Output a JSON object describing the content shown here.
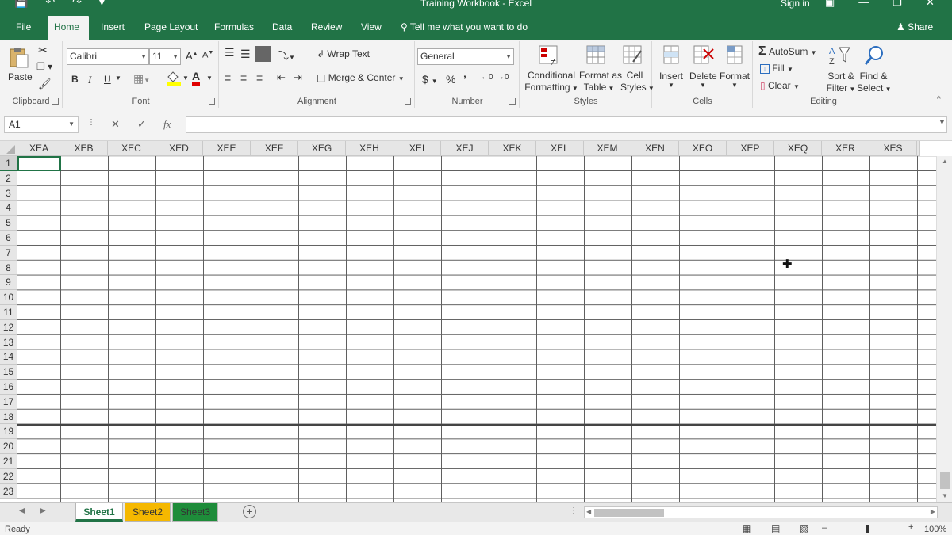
{
  "window": {
    "title": "Training Workbook - Excel",
    "signin": "Sign in"
  },
  "ribbon_tabs": [
    "File",
    "Home",
    "Insert",
    "Page Layout",
    "Formulas",
    "Data",
    "Review",
    "View"
  ],
  "active_tab": "Home",
  "tell_me": "Tell me what you want to do",
  "share": "Share",
  "clipboard": {
    "paste": "Paste",
    "label": "Clipboard"
  },
  "font": {
    "name": "Calibri",
    "size": "11",
    "bold": "B",
    "italic": "I",
    "underline": "U",
    "label": "Font"
  },
  "alignment": {
    "wrap_text": "Wrap Text",
    "merge_center": "Merge & Center",
    "label": "Alignment"
  },
  "number": {
    "format": "General",
    "currency": "$",
    "percent": "%",
    "comma": "’",
    "label": "Number"
  },
  "styles": {
    "conditional_formatting": [
      "Conditional",
      "Formatting"
    ],
    "format_as_table": [
      "Format as",
      "Table"
    ],
    "cell_styles": [
      "Cell",
      "Styles"
    ],
    "label": "Styles"
  },
  "cells_group": {
    "insert": "Insert",
    "delete": "Delete",
    "format": "Format",
    "label": "Cells"
  },
  "editing": {
    "autosum": "AutoSum",
    "fill": "Fill",
    "clear": "Clear",
    "sort_filter": [
      "Sort &",
      "Filter"
    ],
    "find_select": [
      "Find &",
      "Select"
    ],
    "label": "Editing"
  },
  "formula_bar": {
    "name_box": "A1",
    "fx": "fx",
    "value": ""
  },
  "columns": [
    "XEA",
    "XEB",
    "XEC",
    "XED",
    "XEE",
    "XEF",
    "XEG",
    "XEH",
    "XEI",
    "XEJ",
    "XEK",
    "XEL",
    "XEM",
    "XEN",
    "XEO",
    "XEP",
    "XEQ",
    "XER",
    "XES"
  ],
  "rows": [
    "1",
    "2",
    "3",
    "4",
    "5",
    "6",
    "7",
    "8",
    "9",
    "10",
    "11",
    "12",
    "13",
    "14",
    "15",
    "16",
    "17",
    "18",
    "19",
    "20",
    "21",
    "22",
    "23"
  ],
  "selected_cell": "A1",
  "sheets": [
    {
      "name": "Sheet1",
      "color": "#ffffff",
      "active": true
    },
    {
      "name": "Sheet2",
      "color": "#f5b800"
    },
    {
      "name": "Sheet3",
      "color": "#1e8c3a"
    }
  ],
  "status": {
    "text": "Ready",
    "zoom": "100%"
  },
  "colors": {
    "excel_green": "#217346",
    "ribbon_bg": "#f3f3f3"
  }
}
